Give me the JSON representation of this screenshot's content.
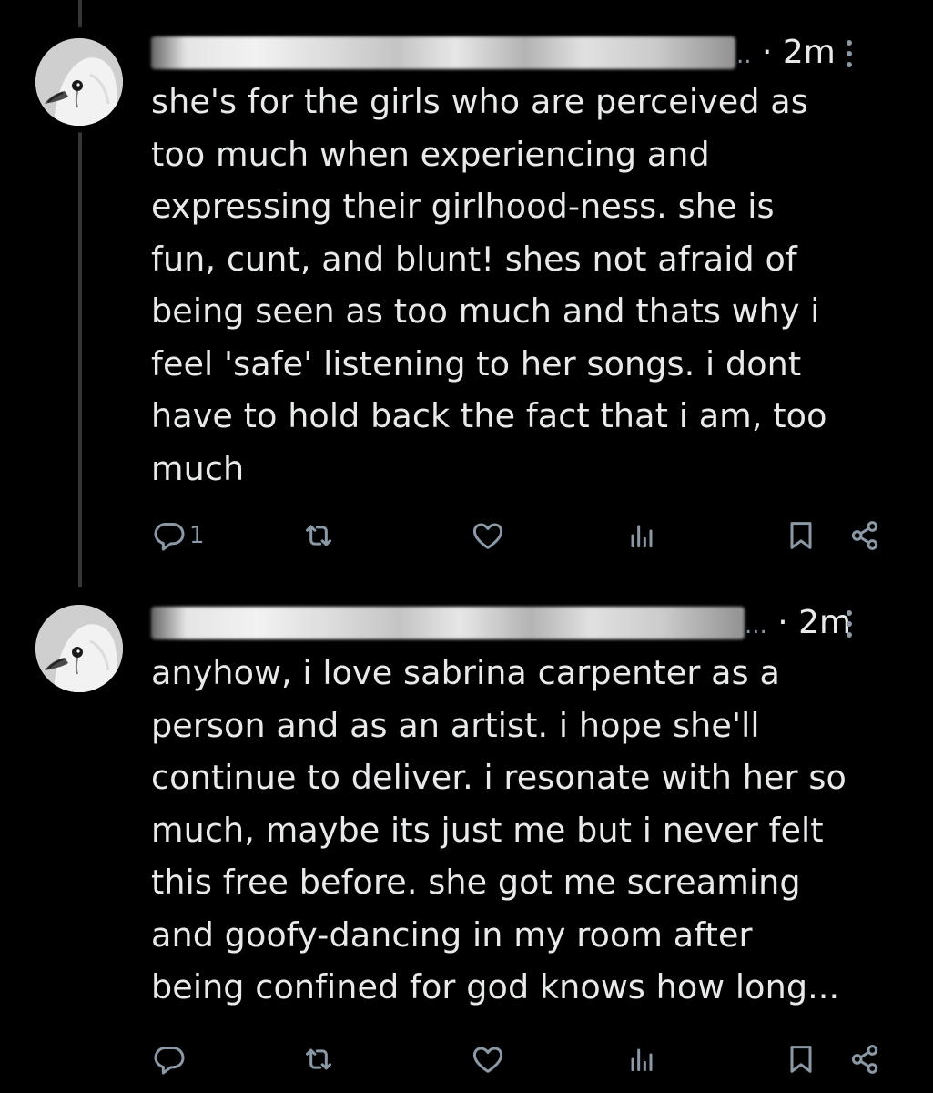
{
  "posts": [
    {
      "time": "2m",
      "ellipsis": "..",
      "separator": "·",
      "text": "she's for the girls who are perceived as\ntoo much when experiencing and\nexpressing their girlhood-ness. she is\nfun, cunt, and blunt! shes not afraid of\nbeing seen as too much and thats why i\nfeel 'safe' listening to her songs. i dont\nhave to hold back the fact that i am, too\nmuch",
      "reply_count": "1"
    },
    {
      "time": "2m",
      "ellipsis": "...",
      "separator": "·",
      "text": "anyhow, i love sabrina carpenter as a\nperson and as an artist. i hope she'll\ncontinue to deliver. i resonate with her so\nmuch, maybe its just me but i never felt\nthis free before. she got me screaming\nand goofy-dancing in my room after\nbeing confined for god knows how long...",
      "reply_count": ""
    }
  ],
  "colors": {
    "background": "#000000",
    "text": "#e7e9ea",
    "secondary": "#8b98a5",
    "thread_line": "#333639"
  },
  "icons": [
    "reply-icon",
    "retweet-icon",
    "like-icon",
    "views-icon",
    "bookmark-icon",
    "share-icon",
    "more-icon"
  ]
}
